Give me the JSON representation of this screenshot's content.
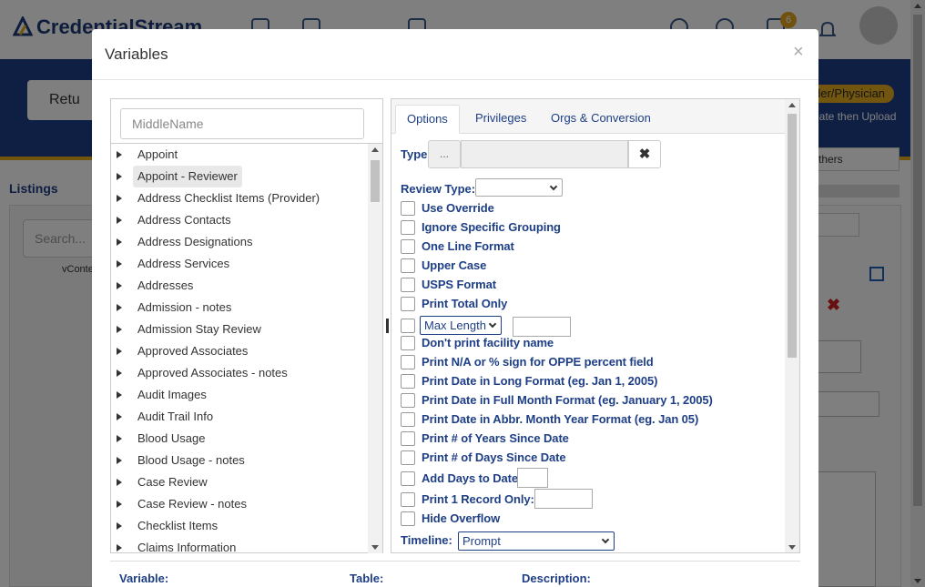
{
  "background": {
    "logo_text": "CredentialStream",
    "notification_count": "6",
    "return_button": "Retu",
    "role_pill": "der/Physician",
    "upload_hint": "eate then Upload",
    "listings_title": "Listings",
    "search_placeholder": "Search...",
    "tree_item": "vConte",
    "others_button": "thers"
  },
  "modal": {
    "title": "Variables",
    "close_icon": "×",
    "search": {
      "placeholder": "MiddleName"
    },
    "list_items": [
      {
        "label": "Appoint"
      },
      {
        "label": "Appoint - Reviewer",
        "selected": true
      },
      {
        "label": "Address Checklist Items (Provider)"
      },
      {
        "label": "Address Contacts"
      },
      {
        "label": "Address Designations"
      },
      {
        "label": "Address Services"
      },
      {
        "label": "Addresses"
      },
      {
        "label": "Admission - notes"
      },
      {
        "label": "Admission Stay Review"
      },
      {
        "label": "Approved Associates"
      },
      {
        "label": "Approved Associates - notes"
      },
      {
        "label": "Audit Images"
      },
      {
        "label": "Audit Trail Info"
      },
      {
        "label": "Blood Usage"
      },
      {
        "label": "Blood Usage - notes"
      },
      {
        "label": "Case Review"
      },
      {
        "label": "Case Review - notes"
      },
      {
        "label": "Checklist Items"
      },
      {
        "label": "Claims Information"
      }
    ],
    "tabs": [
      {
        "label": "Options",
        "active": true
      },
      {
        "label": "Privileges"
      },
      {
        "label": "Orgs & Conversion"
      }
    ],
    "options": {
      "type_label": "Type",
      "type_button": "...",
      "type_clear": "✖",
      "review_type_label": "Review Type:",
      "checkboxes": [
        "Use Override",
        "Ignore Specific Grouping",
        "One Line Format",
        "Upper Case",
        "USPS Format",
        "Print Total Only"
      ],
      "max_length_select": "Max Length",
      "checkboxes2": [
        "Don't print facility name",
        "Print N/A or % sign for OPPE percent field",
        "Print Date in Long Format (eg. Jan 1, 2005)",
        "Print Date in Full Month Format (eg. January 1, 2005)",
        "Print Date in Abbr. Month Year Format (eg. Jan 05)",
        "Print # of Years Since Date",
        "Print # of Days Since Date"
      ],
      "add_days_label": "Add Days to Date",
      "print_record_label": "Print 1 Record Only:",
      "hide_overflow_label": "Hide Overflow",
      "timeline_label": "Timeline:",
      "timeline_value": "Prompt"
    },
    "footer": {
      "variable_label": "Variable:",
      "table_label": "Table:",
      "description_label": "Description:"
    }
  },
  "colors": {
    "brand_blue": "#1e3f86",
    "accent_gold": "#e2a81d"
  }
}
